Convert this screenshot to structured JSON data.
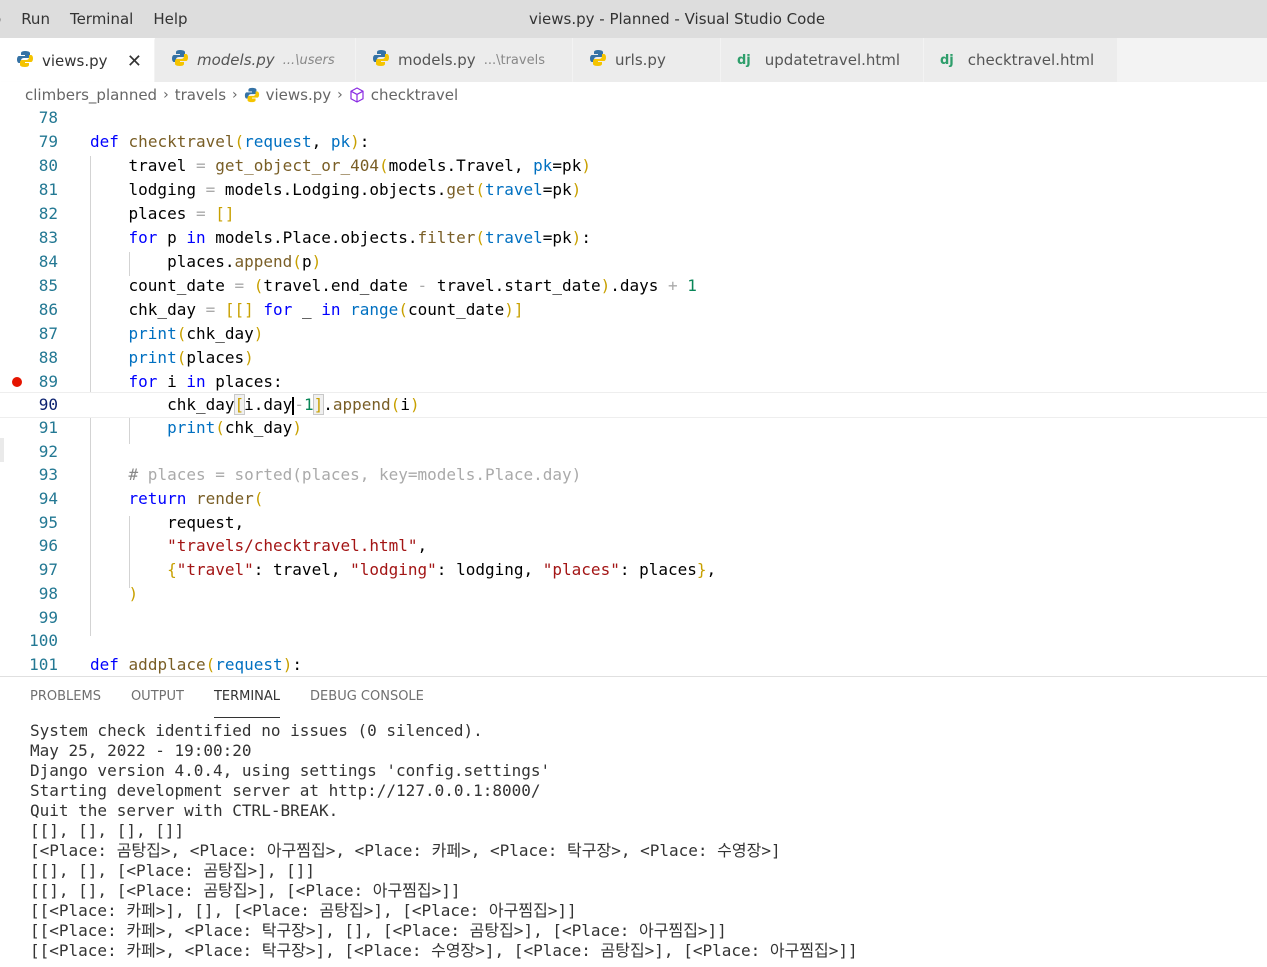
{
  "titlebar": {
    "menu": [
      "o",
      "Run",
      "Terminal",
      "Help"
    ],
    "title": "views.py - Planned - Visual Studio Code"
  },
  "tabs": [
    {
      "label": "views.py",
      "dir": "",
      "icon": "python-icon",
      "active": true
    },
    {
      "label": "models.py",
      "dir": "...\\users",
      "icon": "python-icon",
      "italic": true
    },
    {
      "label": "models.py",
      "dir": "...\\travels",
      "icon": "python-icon"
    },
    {
      "label": "urls.py",
      "dir": "",
      "icon": "python-icon"
    },
    {
      "label": "updatetravel.html",
      "dir": "",
      "icon": "django-icon"
    },
    {
      "label": "checktravel.html",
      "dir": "",
      "icon": "django-icon"
    }
  ],
  "tab_close_glyph": "✕",
  "django_glyph": "dj",
  "breadcrumb": [
    "climbers_planned",
    "travels",
    "views.py",
    "checktravel"
  ],
  "editor": {
    "line_numbers": [
      "78",
      "79",
      "80",
      "81",
      "82",
      "83",
      "84",
      "85",
      "86",
      "87",
      "88",
      "89",
      "90",
      "91",
      "92",
      "93",
      "94",
      "95",
      "96",
      "97",
      "98",
      "99",
      "100",
      "101"
    ],
    "breakpoint_line": "89",
    "current_line": "90"
  },
  "panel": {
    "tabs": [
      "PROBLEMS",
      "OUTPUT",
      "TERMINAL",
      "DEBUG CONSOLE"
    ],
    "active_tab": "TERMINAL",
    "terminal_lines": [
      "System check identified no issues (0 silenced).",
      "May 25, 2022 - 19:00:20",
      "Django version 4.0.4, using settings 'config.settings'",
      "Starting development server at http://127.0.0.1:8000/",
      "Quit the server with CTRL-BREAK.",
      "[[], [], [], []]",
      "[<Place: 곰탕집>, <Place: 아구찜집>, <Place: 카페>, <Place: 탁구장>, <Place: 수영장>]",
      "[[], [], [<Place: 곰탕집>], []]",
      "[[], [], [<Place: 곰탕집>], [<Place: 아구찜집>]]",
      "[[<Place: 카페>], [], [<Place: 곰탕집>], [<Place: 아구찜집>]]",
      "[[<Place: 카페>, <Place: 탁구장>], [], [<Place: 곰탕집>], [<Place: 아구찜집>]]",
      "[[<Place: 카페>, <Place: 탁구장>], [<Place: 수영장>], [<Place: 곰탕집>], [<Place: 아구찜집>]]"
    ]
  },
  "colors": {
    "keyword": "#0000ff",
    "function": "#795e26",
    "parameter": "#0070c1",
    "string": "#a31515",
    "comment": "#008000",
    "line_number": "#237893",
    "breakpoint": "#e51400"
  }
}
